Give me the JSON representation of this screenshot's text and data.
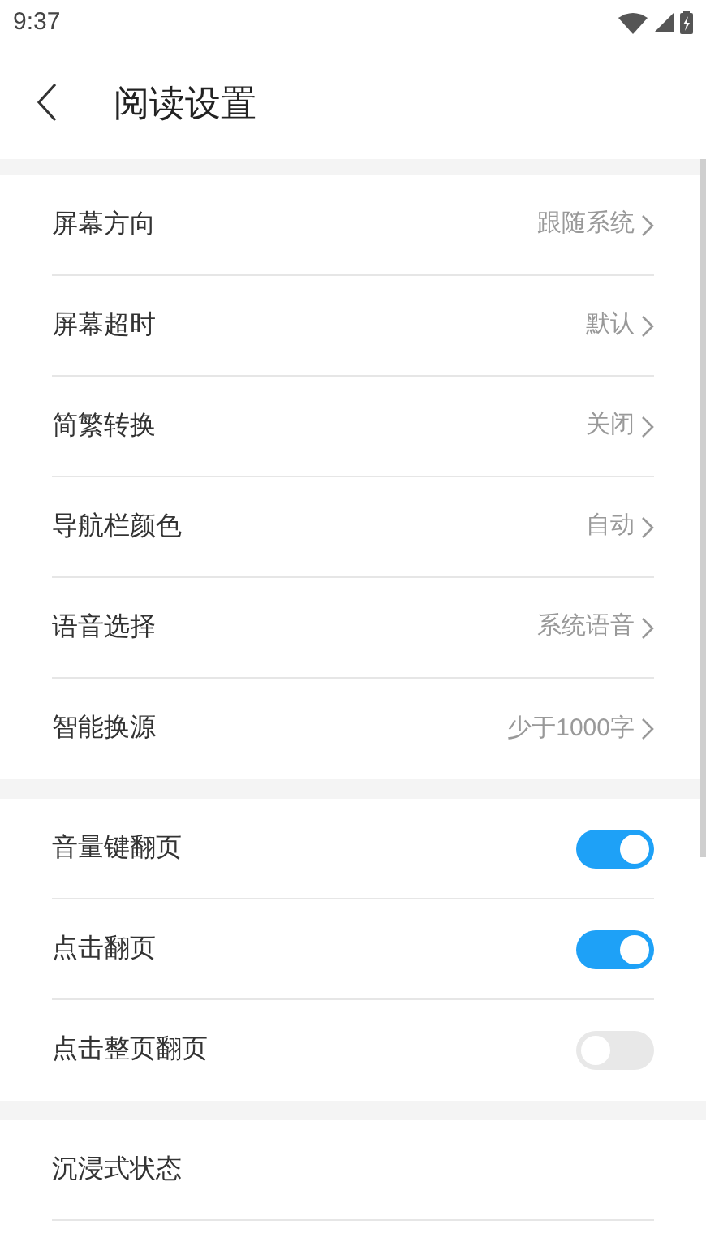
{
  "status_bar": {
    "time": "9:37"
  },
  "header": {
    "title": "阅读设置"
  },
  "groups": [
    {
      "items": [
        {
          "kind": "value",
          "label": "屏幕方向",
          "value": "跟随系统"
        },
        {
          "kind": "value",
          "label": "屏幕超时",
          "value": "默认"
        },
        {
          "kind": "value",
          "label": "简繁转换",
          "value": "关闭"
        },
        {
          "kind": "value",
          "label": "导航栏颜色",
          "value": "自动"
        },
        {
          "kind": "value",
          "label": "语音选择",
          "value": "系统语音"
        },
        {
          "kind": "value",
          "label": "智能换源",
          "value": "少于1000字"
        }
      ]
    },
    {
      "items": [
        {
          "kind": "toggle",
          "label": "音量键翻页",
          "on": true
        },
        {
          "kind": "toggle",
          "label": "点击翻页",
          "on": true
        },
        {
          "kind": "toggle",
          "label": "点击整页翻页",
          "on": false
        }
      ]
    },
    {
      "items": [
        {
          "kind": "plain",
          "label": "沉浸式状态"
        }
      ]
    }
  ]
}
